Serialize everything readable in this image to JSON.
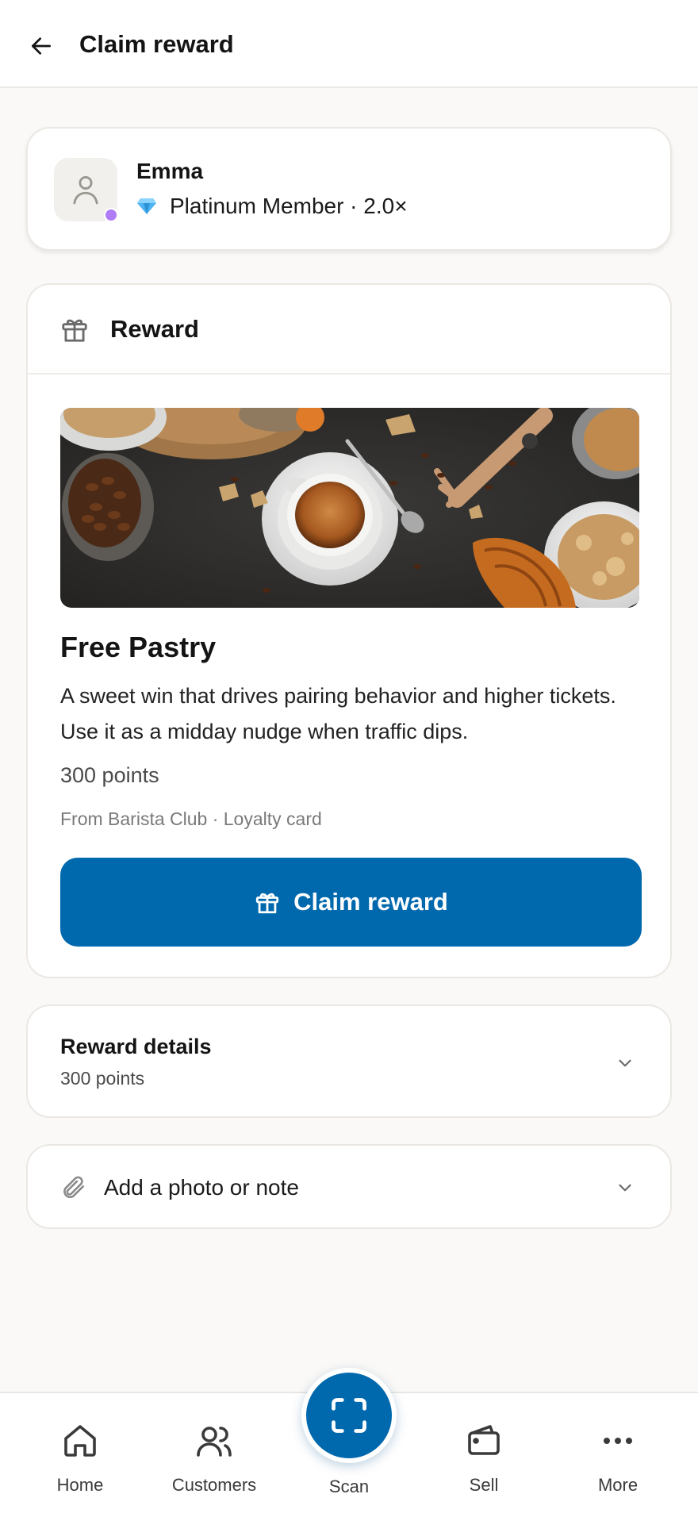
{
  "header": {
    "title": "Claim reward",
    "back_icon": "arrow-left-icon"
  },
  "member": {
    "name": "Emma",
    "tier_icon": "gem-icon",
    "tier_label": "Platinum Member · 2.0×",
    "status_color": "#b07cf5"
  },
  "reward": {
    "section_title": "Reward",
    "section_icon": "gift-icon",
    "title": "Free Pastry",
    "description": "A sweet win that drives pairing behavior and higher tickets. Use it as a midday nudge when traffic dips.",
    "points": "300 points",
    "source": "From Barista Club · Loyalty card",
    "claim_label": "Claim reward",
    "image_subject": "coffee cup, croissant, coffee beans and cereal flakes on dark table"
  },
  "details": {
    "title": "Reward details",
    "subtitle": "300 points"
  },
  "note": {
    "label": "Add a photo or note",
    "icon": "paperclip-icon"
  },
  "nav": {
    "items": [
      {
        "label": "Home",
        "icon": "home-icon"
      },
      {
        "label": "Customers",
        "icon": "users-icon"
      },
      {
        "label": "Scan",
        "icon": "scan-icon"
      },
      {
        "label": "Sell",
        "icon": "wallet-icon"
      },
      {
        "label": "More",
        "icon": "more-icon"
      }
    ]
  },
  "colors": {
    "accent": "#0068ad",
    "background": "#faf9f7"
  }
}
